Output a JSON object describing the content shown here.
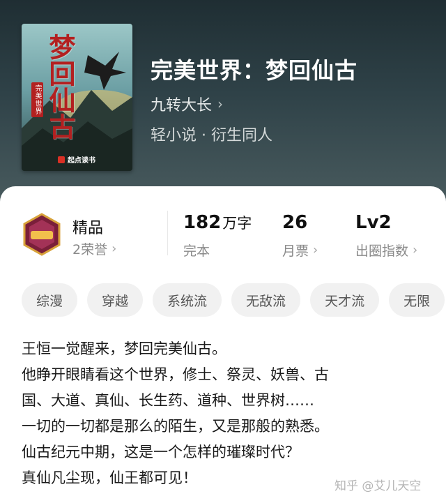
{
  "book": {
    "title": "完美世界：梦回仙古",
    "author": "九转大长",
    "genre": "轻小说 · 衍生同人",
    "cover": {
      "title": "梦回仙古",
      "subtitle": "完美世界",
      "brand": "起点读书"
    }
  },
  "stats": {
    "quality": {
      "label": "精品",
      "honors": "2荣誉"
    },
    "words": {
      "value": "182",
      "unit": "万字",
      "status": "完本"
    },
    "monthly_votes": {
      "value": "26",
      "label": "月票"
    },
    "circle_index": {
      "value": "Lv2",
      "label": "出圈指数"
    }
  },
  "tags": [
    "综漫",
    "穿越",
    "系统流",
    "无敌流",
    "天才流",
    "无限"
  ],
  "description": [
    "王恒一觉醒来，梦回完美仙古。",
    "他睁开眼睛看这个世界，修士、祭灵、妖兽、古",
    "国、大道、真仙、长生药、道种、世界树……",
    "一切的一切都是那么的陌生，又是那般的熟悉。",
    "仙古纪元中期，这是一个怎样的璀璨时代？",
    "真仙凡尘现，仙王都可见！"
  ],
  "watermark": "知乎 @艾儿天空",
  "icons": {
    "chevron": "chevron-right-icon",
    "badge": "quality-badge-icon"
  },
  "colors": {
    "header_dark": "#1f2e33",
    "cover_title_red": "#b32020",
    "tag_bg": "#f1f1f1"
  }
}
